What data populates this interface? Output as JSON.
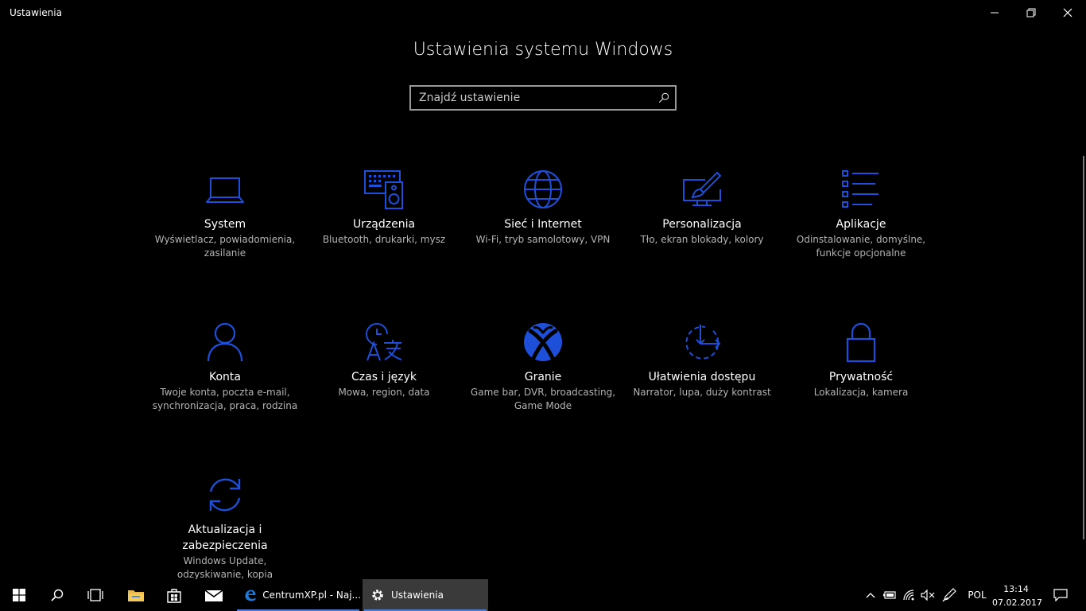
{
  "window": {
    "title": "Ustawienia"
  },
  "header": {
    "title": "Ustawienia systemu Windows"
  },
  "search": {
    "placeholder": "Znajdź ustawienie"
  },
  "tiles": [
    {
      "name": "System",
      "desc": "Wyświetlacz, powiadomienia, zasilanie",
      "icon": "laptop-icon"
    },
    {
      "name": "Urządzenia",
      "desc": "Bluetooth, drukarki, mysz",
      "icon": "devices-icon"
    },
    {
      "name": "Sieć i Internet",
      "desc": "Wi-Fi, tryb samolotowy, VPN",
      "icon": "globe-icon"
    },
    {
      "name": "Personalizacja",
      "desc": "Tło, ekran blokady, kolory",
      "icon": "paint-brush-icon"
    },
    {
      "name": "Aplikacje",
      "desc": "Odinstalowanie, domyślne, funkcje opcjonalne",
      "icon": "apps-list-icon"
    },
    {
      "name": "Konta",
      "desc": "Twoje konta, poczta e-mail, synchronizacja, praca, rodzina",
      "icon": "person-icon"
    },
    {
      "name": "Czas i język",
      "desc": "Mowa, region, data",
      "icon": "time-language-icon"
    },
    {
      "name": "Granie",
      "desc": "Game bar, DVR, broadcasting, Game Mode",
      "icon": "xbox-icon"
    },
    {
      "name": "Ułatwienia dostępu",
      "desc": "Narrator, lupa, duży kontrast",
      "icon": "ease-of-access-icon"
    },
    {
      "name": "Prywatność",
      "desc": "Lokalizacja, kamera",
      "icon": "lock-icon"
    },
    {
      "name": "Aktualizacja i zabezpieczenia",
      "desc": "Windows Update, odzyskiwanie, kopia",
      "icon": "update-sync-icon"
    }
  ],
  "taskbar": {
    "apps": [
      {
        "label": "CentrumXP.pl - Naj...",
        "icon": "edge-icon"
      },
      {
        "label": "Ustawienia",
        "icon": "gear-icon"
      }
    ],
    "language": "POL",
    "time": "13:14",
    "date": "07.02.2017"
  },
  "colors": {
    "accent": "#1e4fd8",
    "background": "#000000"
  }
}
